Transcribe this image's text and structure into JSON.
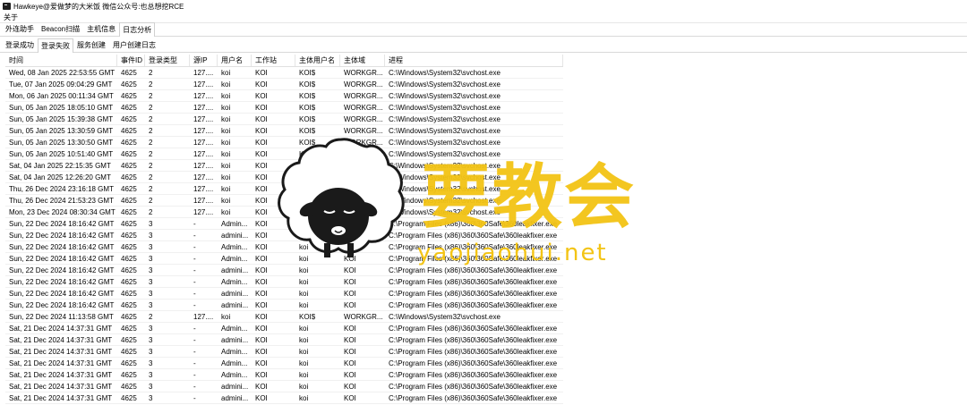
{
  "window": {
    "title": "Hawkeye@爱做梦的大米饭 微信公众号:也总想挖RCE"
  },
  "menu": {
    "items": [
      "关于"
    ]
  },
  "tabs": [
    "外连助手",
    "Beacon扫描",
    "主机信息",
    "日志分析"
  ],
  "active_tab": 3,
  "subtabs": [
    "登录成功",
    "登录失败",
    "服务创建",
    "用户创建日志"
  ],
  "active_subtab": 1,
  "table": {
    "columns": [
      "时间",
      "事件ID",
      "登录类型",
      "源IP",
      "用户名",
      "工作站",
      "主体用户名",
      "主体域",
      "进程"
    ],
    "rows": [
      [
        "Wed, 08 Jan 2025 22:53:55 GMT",
        "4625",
        "2",
        "127....",
        "koi",
        "KOI",
        "KOI$",
        "WORKGR...",
        "C:\\Windows\\System32\\svchost.exe"
      ],
      [
        "Tue, 07 Jan 2025 09:04:29 GMT",
        "4625",
        "2",
        "127....",
        "koi",
        "KOI",
        "KOI$",
        "WORKGR...",
        "C:\\Windows\\System32\\svchost.exe"
      ],
      [
        "Mon, 06 Jan 2025 00:11:34 GMT",
        "4625",
        "2",
        "127....",
        "koi",
        "KOI",
        "KOI$",
        "WORKGR...",
        "C:\\Windows\\System32\\svchost.exe"
      ],
      [
        "Sun, 05 Jan 2025 18:05:10 GMT",
        "4625",
        "2",
        "127....",
        "koi",
        "KOI",
        "KOI$",
        "WORKGR...",
        "C:\\Windows\\System32\\svchost.exe"
      ],
      [
        "Sun, 05 Jan 2025 15:39:38 GMT",
        "4625",
        "2",
        "127....",
        "koi",
        "KOI",
        "KOI$",
        "WORKGR...",
        "C:\\Windows\\System32\\svchost.exe"
      ],
      [
        "Sun, 05 Jan 2025 13:30:59 GMT",
        "4625",
        "2",
        "127....",
        "koi",
        "KOI",
        "KOI$",
        "WORKGR...",
        "C:\\Windows\\System32\\svchost.exe"
      ],
      [
        "Sun, 05 Jan 2025 13:30:50 GMT",
        "4625",
        "2",
        "127....",
        "koi",
        "KOI",
        "KOI$",
        "WORKGR...",
        "C:\\Windows\\System32\\svchost.exe"
      ],
      [
        "Sun, 05 Jan 2025 10:51:40 GMT",
        "4625",
        "2",
        "127....",
        "koi",
        "KOI",
        "KOI$",
        "WORKGR...",
        "C:\\Windows\\System32\\svchost.exe"
      ],
      [
        "Sat, 04 Jan 2025 22:15:35 GMT",
        "4625",
        "2",
        "127....",
        "koi",
        "KOI",
        "KOI$",
        "WORKGR...",
        "C:\\Windows\\System32\\svchost.exe"
      ],
      [
        "Sat, 04 Jan 2025 12:26:20 GMT",
        "4625",
        "2",
        "127....",
        "koi",
        "KOI",
        "KOI$",
        "WORKGR...",
        "C:\\Windows\\System32\\svchost.exe"
      ],
      [
        "Thu, 26 Dec 2024 23:16:18 GMT",
        "4625",
        "2",
        "127....",
        "koi",
        "KOI",
        "KOI$",
        "WORKGR...",
        "C:\\Windows\\System32\\svchost.exe"
      ],
      [
        "Thu, 26 Dec 2024 21:53:23 GMT",
        "4625",
        "2",
        "127....",
        "koi",
        "KOI",
        "KOI$",
        "WORKGR...",
        "C:\\Windows\\System32\\svchost.exe"
      ],
      [
        "Mon, 23 Dec 2024 08:30:34 GMT",
        "4625",
        "2",
        "127....",
        "koi",
        "KOI",
        "KOI$",
        "WORKGR...",
        "C:\\Windows\\System32\\svchost.exe"
      ],
      [
        "Sun, 22 Dec 2024 18:16:42 GMT",
        "4625",
        "3",
        "-",
        "Admin...",
        "KOI",
        "koi",
        "KOI",
        "C:\\Program Files (x86)\\360\\360Safe\\360leakfixer.exe"
      ],
      [
        "Sun, 22 Dec 2024 18:16:42 GMT",
        "4625",
        "3",
        "-",
        "admini...",
        "KOI",
        "koi",
        "KOI",
        "C:\\Program Files (x86)\\360\\360Safe\\360leakfixer.exe"
      ],
      [
        "Sun, 22 Dec 2024 18:16:42 GMT",
        "4625",
        "3",
        "-",
        "Admin...",
        "KOI",
        "koi",
        "KOI",
        "C:\\Program Files (x86)\\360\\360Safe\\360leakfixer.exe"
      ],
      [
        "Sun, 22 Dec 2024 18:16:42 GMT",
        "4625",
        "3",
        "-",
        "Admin...",
        "KOI",
        "koi",
        "KOI",
        "C:\\Program Files (x86)\\360\\360Safe\\360leakfixer.exe"
      ],
      [
        "Sun, 22 Dec 2024 18:16:42 GMT",
        "4625",
        "3",
        "-",
        "admini...",
        "KOI",
        "koi",
        "KOI",
        "C:\\Program Files (x86)\\360\\360Safe\\360leakfixer.exe"
      ],
      [
        "Sun, 22 Dec 2024 18:16:42 GMT",
        "4625",
        "3",
        "-",
        "Admin...",
        "KOI",
        "koi",
        "KOI",
        "C:\\Program Files (x86)\\360\\360Safe\\360leakfixer.exe"
      ],
      [
        "Sun, 22 Dec 2024 18:16:42 GMT",
        "4625",
        "3",
        "-",
        "admini...",
        "KOI",
        "koi",
        "KOI",
        "C:\\Program Files (x86)\\360\\360Safe\\360leakfixer.exe"
      ],
      [
        "Sun, 22 Dec 2024 18:16:42 GMT",
        "4625",
        "3",
        "-",
        "admini...",
        "KOI",
        "koi",
        "KOI",
        "C:\\Program Files (x86)\\360\\360Safe\\360leakfixer.exe"
      ],
      [
        "Sun, 22 Dec 2024 11:13:58 GMT",
        "4625",
        "2",
        "127....",
        "koi",
        "KOI",
        "KOI$",
        "WORKGR...",
        "C:\\Windows\\System32\\svchost.exe"
      ],
      [
        "Sat, 21 Dec 2024 14:37:31 GMT",
        "4625",
        "3",
        "-",
        "Admin...",
        "KOI",
        "koi",
        "KOI",
        "C:\\Program Files (x86)\\360\\360Safe\\360leakfixer.exe"
      ],
      [
        "Sat, 21 Dec 2024 14:37:31 GMT",
        "4625",
        "3",
        "-",
        "admini...",
        "KOI",
        "koi",
        "KOI",
        "C:\\Program Files (x86)\\360\\360Safe\\360leakfixer.exe"
      ],
      [
        "Sat, 21 Dec 2024 14:37:31 GMT",
        "4625",
        "3",
        "-",
        "Admin...",
        "KOI",
        "koi",
        "KOI",
        "C:\\Program Files (x86)\\360\\360Safe\\360leakfixer.exe"
      ],
      [
        "Sat, 21 Dec 2024 14:37:31 GMT",
        "4625",
        "3",
        "-",
        "Admin...",
        "KOI",
        "koi",
        "KOI",
        "C:\\Program Files (x86)\\360\\360Safe\\360leakfixer.exe"
      ],
      [
        "Sat, 21 Dec 2024 14:37:31 GMT",
        "4625",
        "3",
        "-",
        "Admin...",
        "KOI",
        "koi",
        "KOI",
        "C:\\Program Files (x86)\\360\\360Safe\\360leakfixer.exe"
      ],
      [
        "Sat, 21 Dec 2024 14:37:31 GMT",
        "4625",
        "3",
        "-",
        "admini...",
        "KOI",
        "koi",
        "KOI",
        "C:\\Program Files (x86)\\360\\360Safe\\360leakfixer.exe"
      ],
      [
        "Sat, 21 Dec 2024 14:37:31 GMT",
        "4625",
        "3",
        "-",
        "admini...",
        "KOI",
        "koi",
        "KOI",
        "C:\\Program Files (x86)\\360\\360Safe\\360leakfixer.exe"
      ]
    ]
  },
  "watermark": {
    "text": "要教会",
    "url": "yaojiaohui.net",
    "color": "#f3c415"
  }
}
